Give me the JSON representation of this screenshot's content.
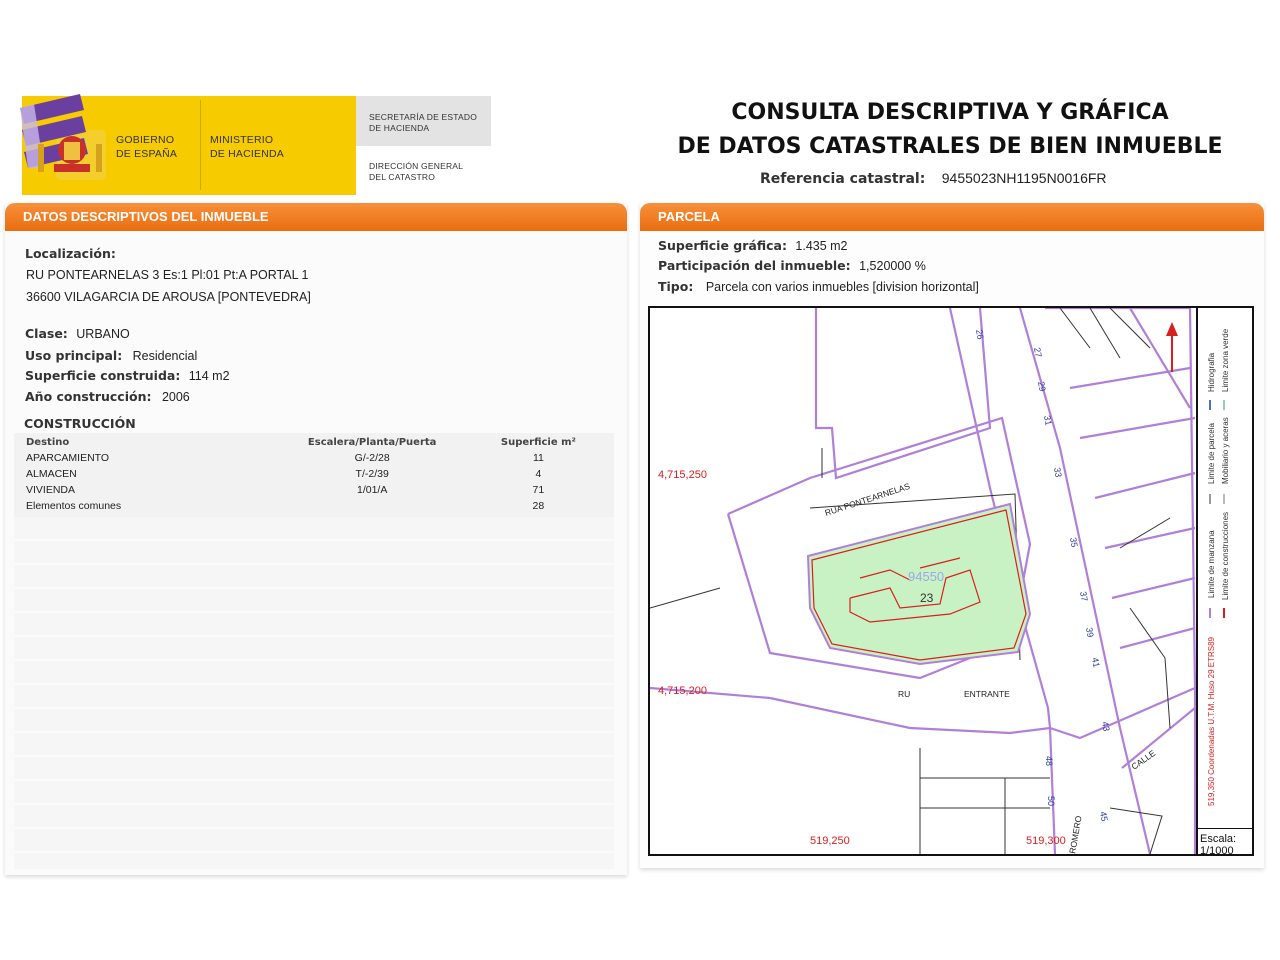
{
  "header": {
    "gov_line1": "GOBIERNO",
    "gov_line2": "DE ESPAÑA",
    "min_line1": "MINISTERIO",
    "min_line2": "DE HACIENDA",
    "sec_line1": "SECRETARÍA DE ESTADO",
    "sec_line2": "DE HACIENDA",
    "dir_line1": "DIRECCIÓN GENERAL",
    "dir_line2": "DEL CATASTRO",
    "title_line1": "CONSULTA DESCRIPTIVA Y GRÁFICA",
    "title_line2": "DE DATOS CATASTRALES DE BIEN INMUEBLE",
    "ref_label": "Referencia catastral:",
    "ref_value": "9455023NH1195N0016FR"
  },
  "left": {
    "section_title": "DATOS DESCRIPTIVOS DEL INMUEBLE",
    "localizacion_label": "Localización:",
    "address_line1": "RU PONTEARNELAS 3 Es:1 Pl:01 Pt:A PORTAL 1",
    "address_line2": "36600 VILAGARCIA DE AROUSA [PONTEVEDRA]",
    "clase_label": "Clase:",
    "clase_value": "URBANO",
    "uso_label": "Uso principal:",
    "uso_value": "Residencial",
    "sup_label": "Superficie construida:",
    "sup_value": "114 m2",
    "anio_label": "Año construcción:",
    "anio_value": "2006",
    "construccion_title": "CONSTRUCCIÓN",
    "table_headers": [
      "Destino",
      "Escalera/Planta/Puerta",
      "Superficie m²"
    ],
    "rows": [
      {
        "destino": "APARCAMIENTO",
        "epp": "G/-2/28",
        "sup": "11"
      },
      {
        "destino": "ALMACEN",
        "epp": "T/-2/39",
        "sup": "4"
      },
      {
        "destino": "VIVIENDA",
        "epp": "1/01/A",
        "sup": "71"
      },
      {
        "destino": "Elementos comunes",
        "epp": "",
        "sup": "28"
      }
    ]
  },
  "right": {
    "section_title": "PARCELA",
    "sup_grafica_label": "Superficie gráfica:",
    "sup_grafica_value": "1.435 m2",
    "participacion_label": "Participación del inmueble:",
    "participacion_value": "1,520000 %",
    "tipo_label": "Tipo:",
    "tipo_value": "Parcela con varios inmuebles [division horizontal]"
  },
  "map": {
    "coord_y_top": "4,715,250",
    "coord_y_bottom": "4,715,200",
    "coord_x_left": "519,250",
    "coord_x_right": "519,300",
    "street_top": "RUA PONTEARNELAS",
    "street_ru": "RU",
    "street_entrante": "ENTRANTE",
    "street_calle": "CALLE",
    "street_romero": "ROMERO",
    "parcel_id": "94550",
    "parcel_num": "23",
    "house_numbers": [
      "26",
      "27",
      "29",
      "31",
      "33",
      "35",
      "37",
      "39",
      "41",
      "43",
      "48",
      "50",
      "45"
    ],
    "legend_col1": [
      "Limite de manzana",
      "Limite de parcela",
      "Hidrografia"
    ],
    "legend_col2": [
      "Limite de construcciones",
      "Mobiliario y aceras",
      "Limite zona verde"
    ],
    "legend_coords": "519,350 Coordenadas U.T.M. Huso 29 ETRS89",
    "scale_label": "Escala:",
    "scale_value": "1/1000",
    "colors": {
      "manzana": "#b07fd8",
      "construccion": "#d81e1e",
      "green": "#c9f2c4"
    }
  }
}
